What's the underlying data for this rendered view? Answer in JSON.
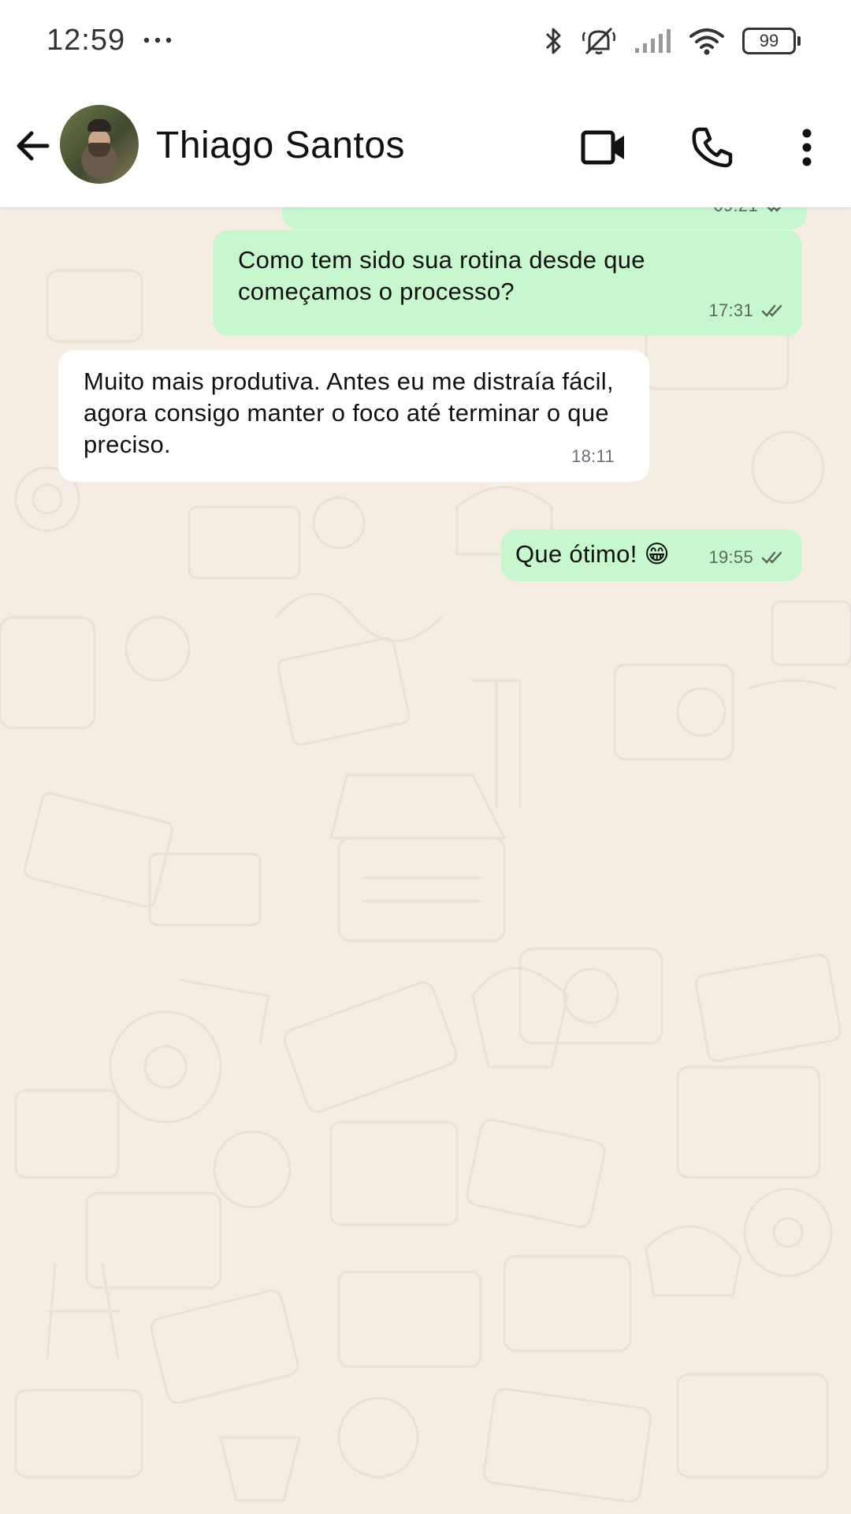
{
  "status_bar": {
    "time": "12:59",
    "battery": "99"
  },
  "header": {
    "contact_name": "Thiago Santos"
  },
  "messages": [
    {
      "direction": "outgoing",
      "text": "",
      "time": "09:21",
      "ticks": "double"
    },
    {
      "direction": "outgoing",
      "text": "Como tem sido sua rotina desde que começamos o processo?",
      "time": "17:31",
      "ticks": "double"
    },
    {
      "direction": "incoming",
      "text": "Muito mais produtiva. Antes eu me distraía fácil, agora consigo manter o foco até terminar o que preciso.",
      "time": "18:11"
    },
    {
      "direction": "outgoing",
      "text": "Que ótimo! 😁",
      "time": "19:55",
      "ticks": "double"
    }
  ],
  "colors": {
    "outgoing_bubble": "#c7f7cc",
    "incoming_bubble": "#ffffff",
    "chat_background": "#f5ede3"
  },
  "icons": [
    "more-dots-icon",
    "bluetooth-icon",
    "silent-icon",
    "signal-icon",
    "wifi-icon",
    "battery-icon",
    "back-arrow-icon",
    "video-call-icon",
    "phone-icon",
    "kebab-menu-icon",
    "double-check-icon"
  ]
}
